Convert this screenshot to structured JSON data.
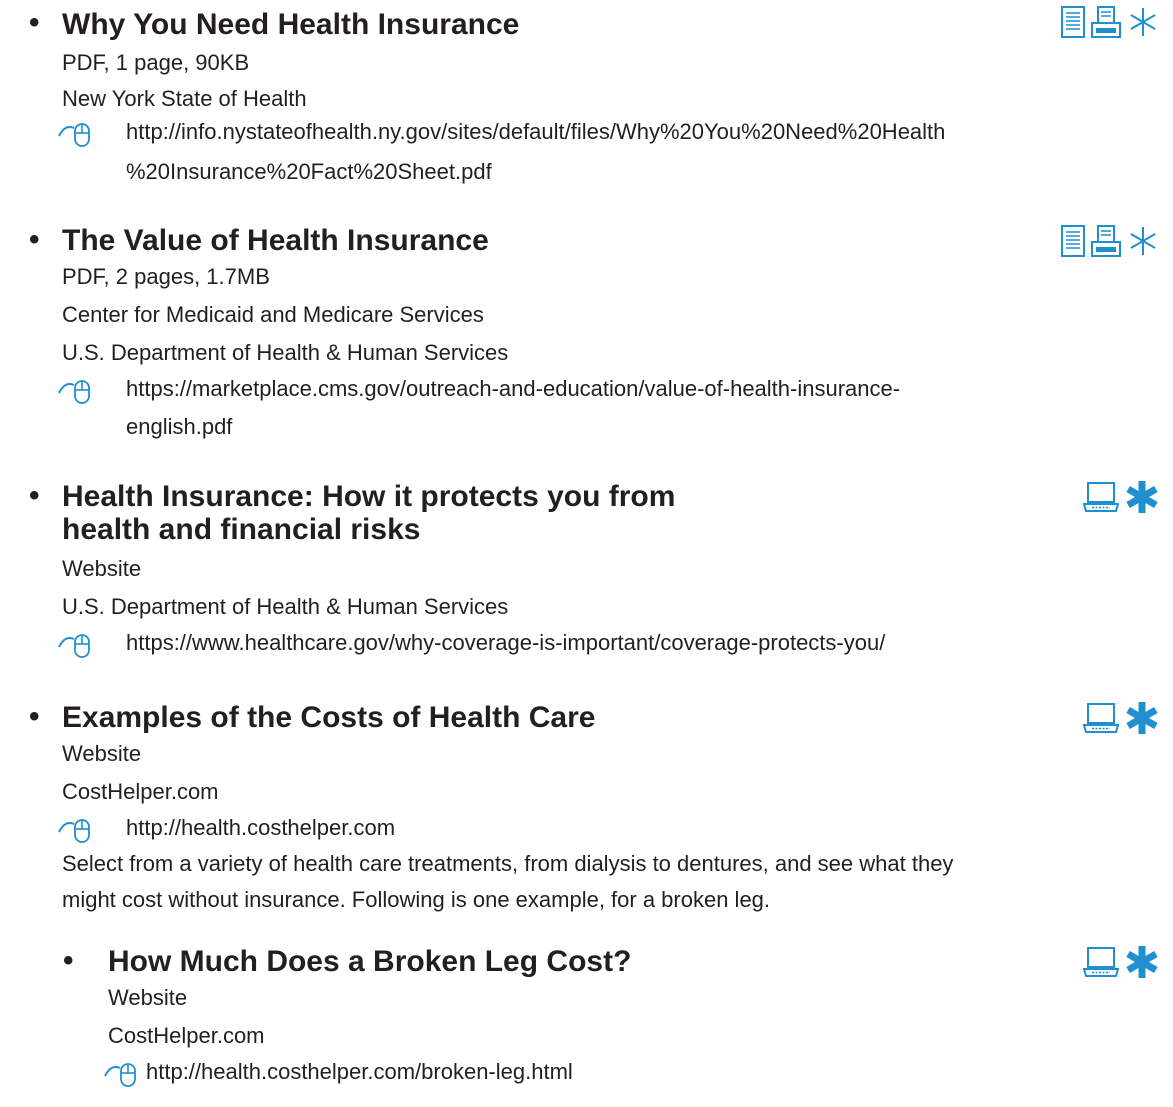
{
  "colors": {
    "text": "#231f20",
    "accent": "#1f8fd0"
  },
  "resources": [
    {
      "bullet": "•",
      "title": "Why You Need Health Insurance",
      "meta": [
        "PDF, 1 page, 90KB",
        "New York State of Health"
      ],
      "url_lines": [
        "http://info.nystateofhealth.ny.gov/sites/default/files/Why%20You%20Need%20Health",
        "%20Insurance%20Fact%20Sheet.pdf"
      ],
      "icons": [
        "document-icon",
        "printer-icon",
        "asterisk-outline-icon"
      ]
    },
    {
      "bullet": "•",
      "title": "The Value of Health Insurance",
      "meta": [
        "PDF, 2 pages, 1.7MB",
        "Center for Medicaid and Medicare Services",
        "U.S. Department of Health & Human Services"
      ],
      "url_lines": [
        "https://marketplace.cms.gov/outreach-and-education/value-of-health-insurance-",
        "english.pdf"
      ],
      "icons": [
        "document-icon",
        "printer-icon",
        "asterisk-outline-icon"
      ]
    },
    {
      "bullet": "•",
      "title_lines": [
        "Health Insurance: How it protects you from",
        "health and financial risks"
      ],
      "meta": [
        "Website",
        "U.S. Department of Health & Human Services"
      ],
      "url_lines": [
        "https://www.healthcare.gov/why-coverage-is-important/coverage-protects-you/"
      ],
      "icons": [
        "laptop-icon",
        "asterisk-solid-icon"
      ]
    },
    {
      "bullet": "•",
      "title": "Examples of the Costs of Health Care",
      "meta": [
        "Website",
        "CostHelper.com"
      ],
      "url_lines": [
        "http://health.costhelper.com"
      ],
      "description_lines": [
        "Select from a variety of health care treatments, from dialysis to dentures, and see what they",
        "might cost without insurance. Following is one example, for a broken leg."
      ],
      "icons": [
        "laptop-icon",
        "asterisk-solid-icon"
      ]
    },
    {
      "bullet": "•",
      "title": "How Much Does a Broken Leg Cost?",
      "meta": [
        "Website",
        "CostHelper.com"
      ],
      "url_lines": [
        "http://health.costhelper.com/broken-leg.html"
      ],
      "icons": [
        "laptop-icon",
        "asterisk-solid-icon"
      ]
    }
  ]
}
